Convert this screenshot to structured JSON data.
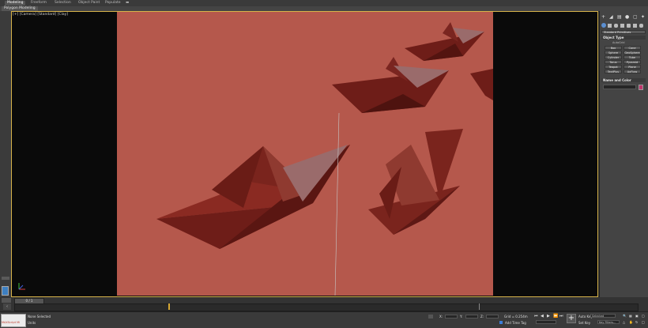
{
  "ribbon": {
    "tabs": [
      "Modeling",
      "Freeform",
      "Selection",
      "Object Paint",
      "Populate"
    ],
    "active_tab": "Modeling",
    "subtab": "Polygon Modeling",
    "more_icon": "ellipsis-icon"
  },
  "viewport": {
    "label": "[+] [Camera] [Standard] [Clay]",
    "background_color": "#b5584c",
    "border_color": "#d7b34a",
    "objects": [
      "paper-boat-large",
      "paper-boat-top",
      "paper-boat-middle",
      "paper-boat-right",
      "paper-boat-partial"
    ]
  },
  "command_panel": {
    "tab_icons": [
      "plus-icon",
      "modify-icon",
      "hierarchy-icon",
      "motion-icon",
      "display-icon",
      "utilities-icon"
    ],
    "category_icons": [
      "geometry-icon",
      "shapes-icon",
      "lights-icon",
      "cameras-icon",
      "helpers-icon",
      "spacewarps-icon",
      "systems-icon"
    ],
    "dropdown": "Standard Primitives",
    "object_type_title": "Object Type",
    "autogrid": "AutoGrid",
    "buttons": [
      "Box",
      "Cone",
      "Sphere",
      "GeoSphere",
      "Cylinder",
      "Tube",
      "Torus",
      "Pyramid",
      "Teapot",
      "Plane",
      "TextPlus",
      "AxFlow"
    ],
    "name_color_title": "Name and Color",
    "swatch_color": "#c0356c"
  },
  "timeline": {
    "frame": "0 / 1"
  },
  "status": {
    "maxscript": "MAXScript Mi",
    "selection": "None Selected",
    "units": "Units",
    "x_label": "X:",
    "y_label": "Y:",
    "z_label": "Z:",
    "grid": "Grid = 0.254m",
    "add_time_tag": "Add Time Tag",
    "auto_key": "Auto Key",
    "set_key": "Set Key",
    "selected": "Selected",
    "key_filters": "Key Filters..."
  }
}
